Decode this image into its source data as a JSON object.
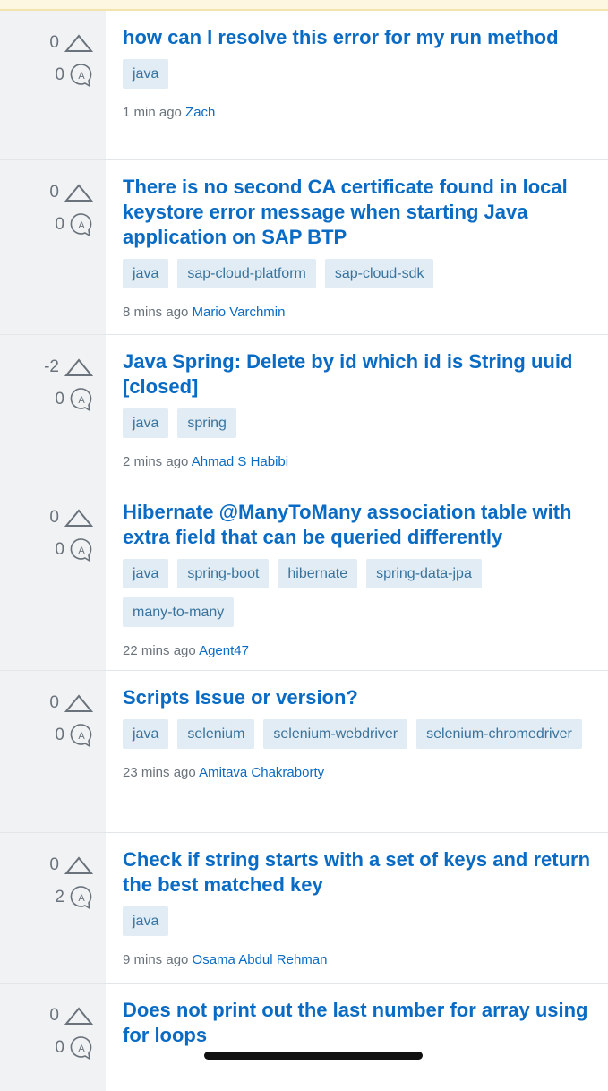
{
  "questions": [
    {
      "votes": "0",
      "answers": "0",
      "title": "how can I resolve this error for my run method",
      "tags": [
        "java"
      ],
      "time": "1 min ago",
      "user": "Zach"
    },
    {
      "votes": "0",
      "answers": "0",
      "title": "There is no second CA certificate found in local keystore error message when starting Java application on SAP BTP",
      "tags": [
        "java",
        "sap-cloud-platform",
        "sap-cloud-sdk"
      ],
      "time": "8 mins ago",
      "user": "Mario Varchmin"
    },
    {
      "votes": "-2",
      "answers": "0",
      "title": "Java Spring: Delete by id which id is String uuid [closed]",
      "tags": [
        "java",
        "spring"
      ],
      "time": "2 mins ago",
      "user": "Ahmad S Habibi"
    },
    {
      "votes": "0",
      "answers": "0",
      "title": "Hibernate @ManyToMany association table with extra field that can be queried differently",
      "tags": [
        "java",
        "spring-boot",
        "hibernate",
        "spring-data-jpa",
        "many-to-many"
      ],
      "time": "22 mins ago",
      "user": "Agent47"
    },
    {
      "votes": "0",
      "answers": "0",
      "title": "Scripts Issue or version?",
      "tags": [
        "java",
        "selenium",
        "selenium-webdriver",
        "selenium-chromedriver"
      ],
      "time": "23 mins ago",
      "user": "Amitava Chakraborty"
    },
    {
      "votes": "0",
      "answers": "2",
      "title": "Check if string starts with a set of keys and return the best matched key",
      "tags": [
        "java"
      ],
      "time": "9 mins ago",
      "user": "Osama Abdul Rehman"
    },
    {
      "votes": "0",
      "answers": "0",
      "title": "Does not print out the last number for array using for loops",
      "tags": [],
      "time": "",
      "user": ""
    }
  ],
  "icons": {
    "vote": "upvote-triangle-icon",
    "answer": "answer-bubble-icon"
  },
  "colors": {
    "title": "#0a6bc4",
    "tag_bg": "#e1ecf4",
    "tag_text": "#39739d",
    "stats_bg": "#f1f2f3"
  }
}
